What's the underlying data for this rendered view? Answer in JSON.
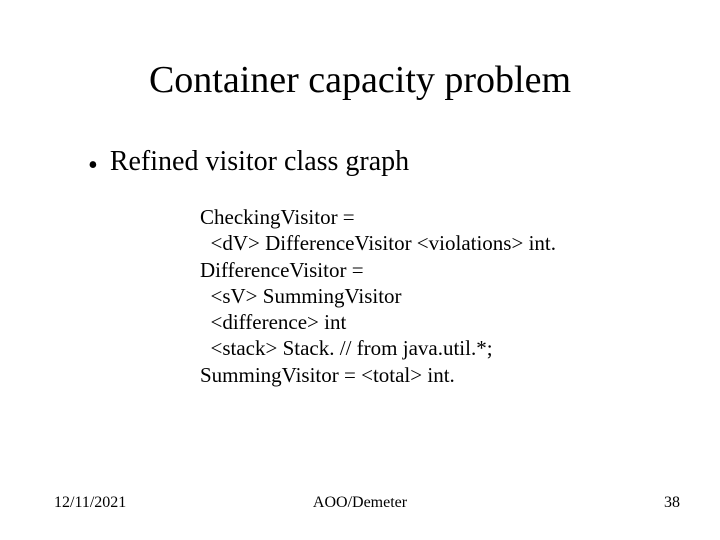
{
  "title": "Container capacity problem",
  "bullet": "Refined visitor class graph",
  "code": "CheckingVisitor =\n  <dV> DifferenceVisitor <violations> int.\nDifferenceVisitor =\n  <sV> SummingVisitor\n  <difference> int\n  <stack> Stack. // from java.util.*;\nSummingVisitor = <total> int.",
  "footer": {
    "date": "12/11/2021",
    "center": "AOO/Demeter",
    "page": "38"
  }
}
